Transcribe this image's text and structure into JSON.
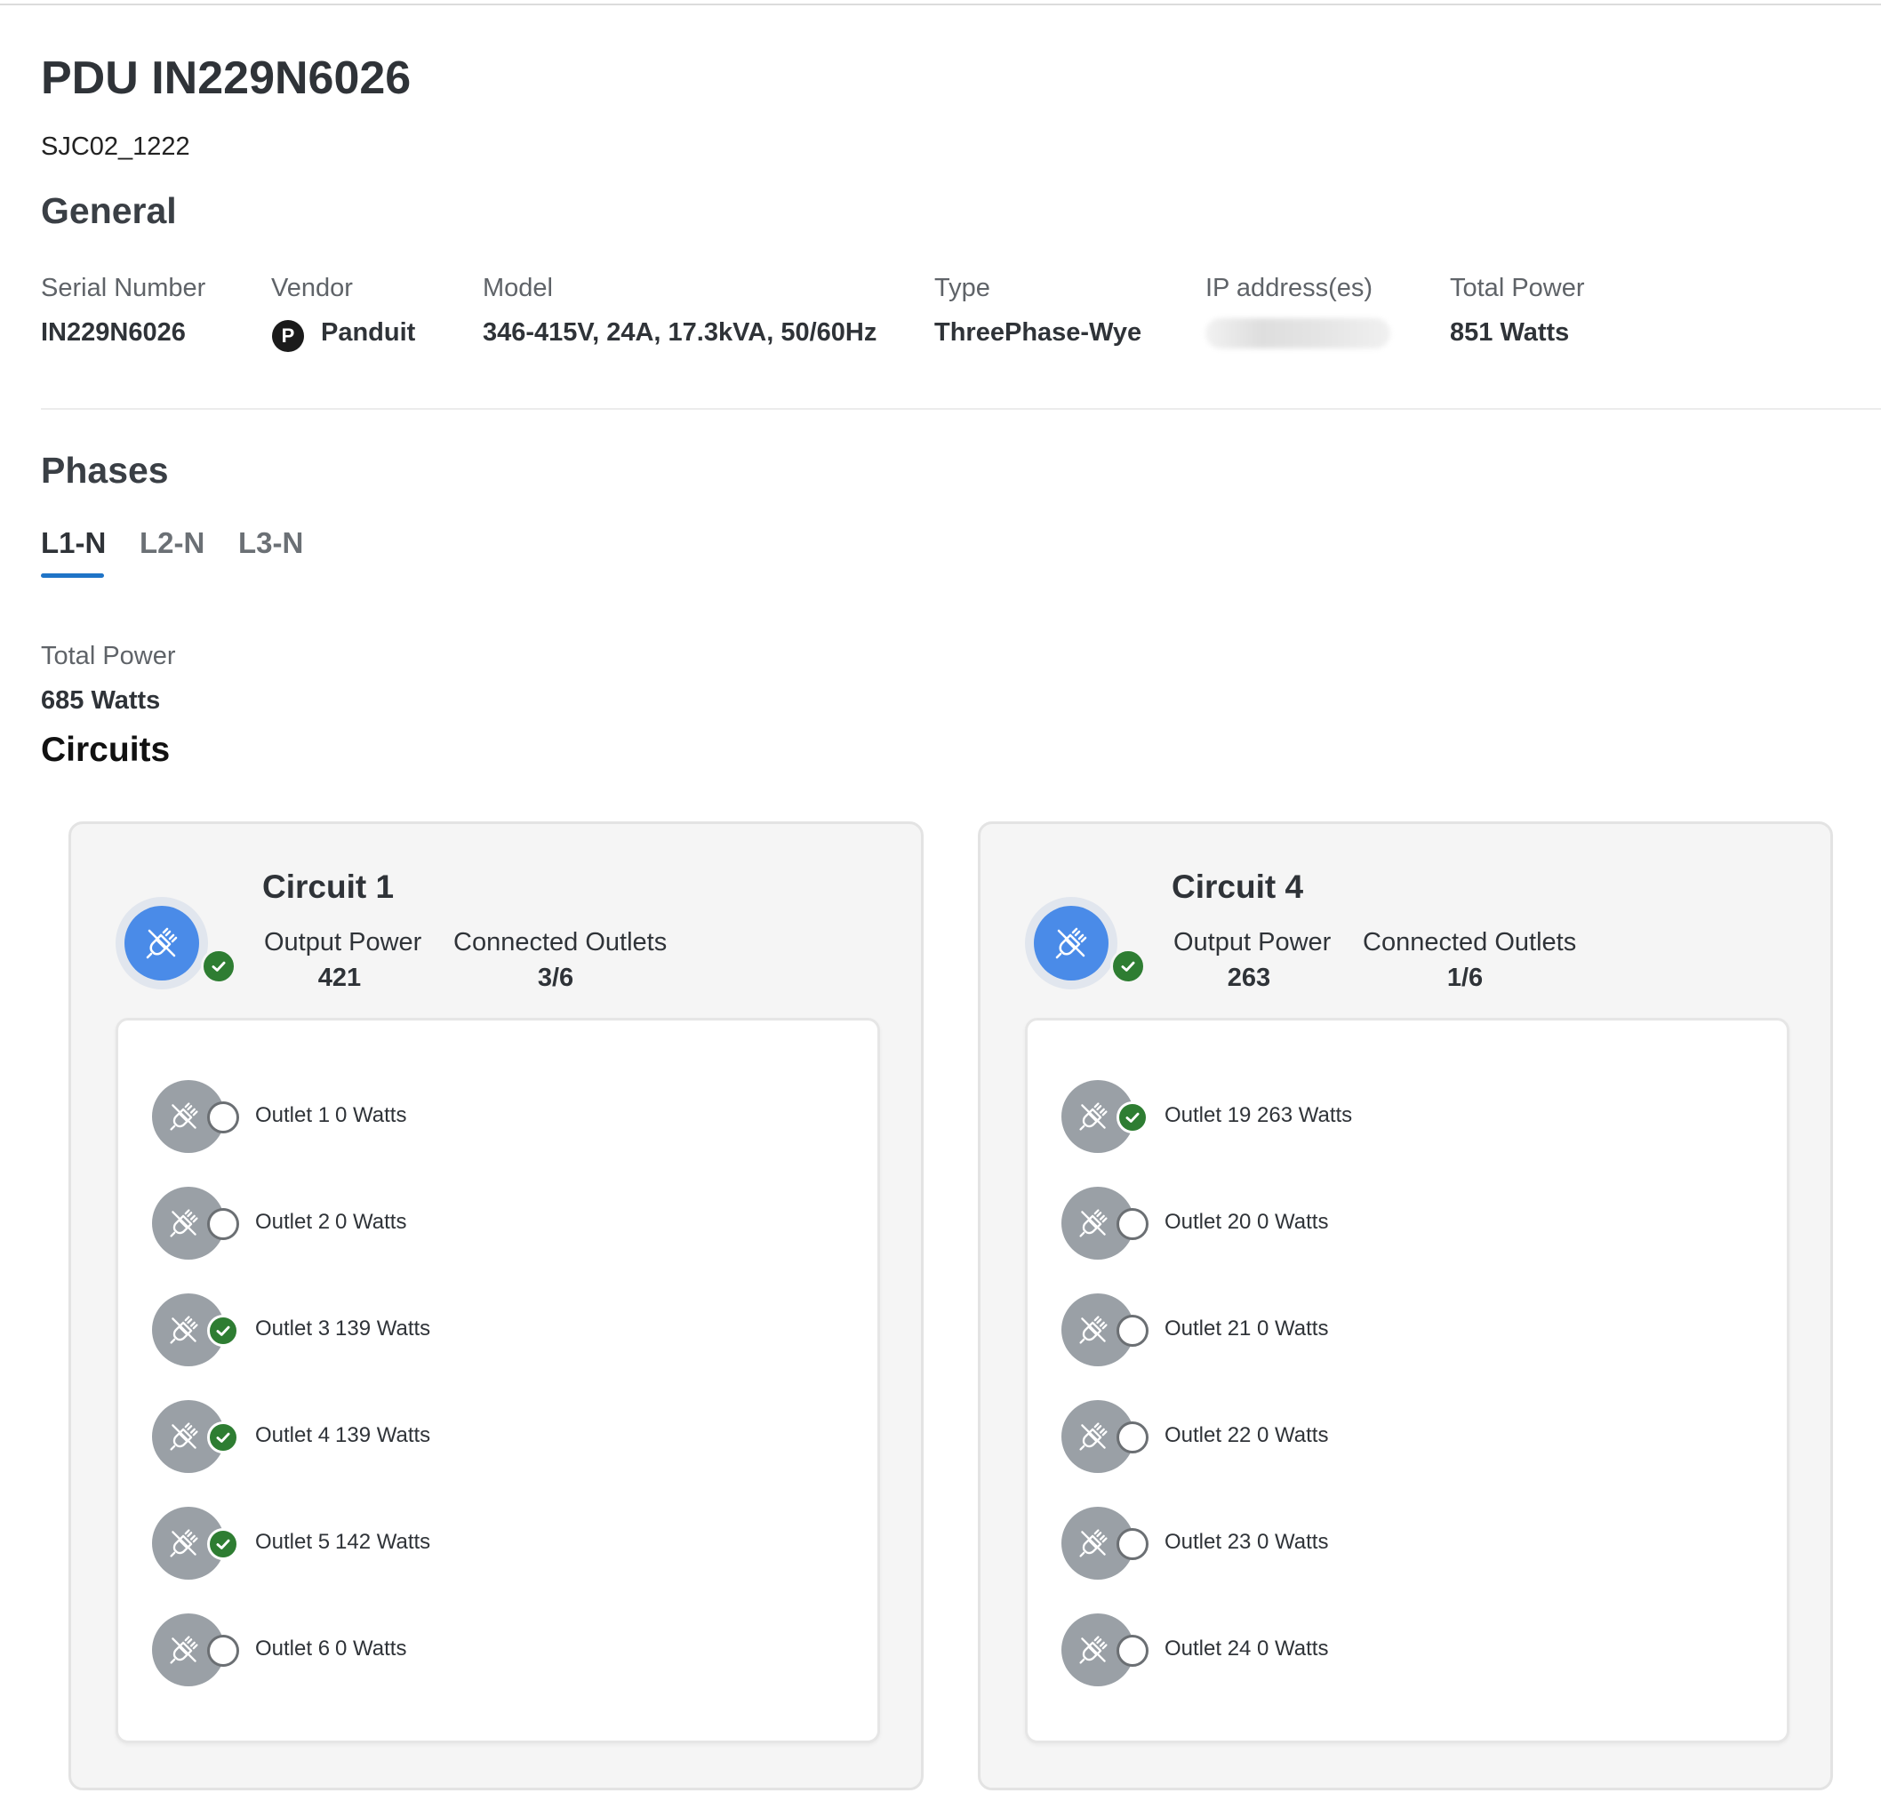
{
  "header": {
    "title": "PDU IN229N6026",
    "subtitle": "SJC02_1222"
  },
  "general": {
    "heading": "General",
    "fields": {
      "serial_label": "Serial Number",
      "serial_value": "IN229N6026",
      "vendor_label": "Vendor",
      "vendor_logo_letter": "P",
      "vendor_value": "Panduit",
      "model_label": "Model",
      "model_value": "346-415V, 24A, 17.3kVA, 50/60Hz",
      "type_label": "Type",
      "type_value": "ThreePhase-Wye",
      "ip_label": "IP address(es)",
      "power_label": "Total Power",
      "power_value": "851 Watts"
    }
  },
  "phases": {
    "heading": "Phases",
    "tabs": [
      {
        "label": "L1-N",
        "active": true
      },
      {
        "label": "L2-N",
        "active": false
      },
      {
        "label": "L3-N",
        "active": false
      }
    ],
    "total_power_label": "Total Power",
    "total_power_value": "685 Watts"
  },
  "circuits": {
    "heading": "Circuits",
    "output_power_label": "Output Power",
    "connected_outlets_label": "Connected Outlets",
    "items": [
      {
        "name": "Circuit 1",
        "status": "ok",
        "output_power": "421",
        "connected_outlets": "3/6",
        "outlets": [
          {
            "name": "Outlet 1",
            "power": "0 Watts",
            "connected": false
          },
          {
            "name": "Outlet 2",
            "power": "0 Watts",
            "connected": false
          },
          {
            "name": "Outlet 3",
            "power": "139 Watts",
            "connected": true
          },
          {
            "name": "Outlet 4",
            "power": "139 Watts",
            "connected": true
          },
          {
            "name": "Outlet 5",
            "power": "142 Watts",
            "connected": true
          },
          {
            "name": "Outlet 6",
            "power": "0 Watts",
            "connected": false
          }
        ]
      },
      {
        "name": "Circuit 4",
        "status": "ok",
        "output_power": "263",
        "connected_outlets": "1/6",
        "outlets": [
          {
            "name": "Outlet 19",
            "power": "263 Watts",
            "connected": true
          },
          {
            "name": "Outlet 20",
            "power": "0 Watts",
            "connected": false
          },
          {
            "name": "Outlet 21",
            "power": "0 Watts",
            "connected": false
          },
          {
            "name": "Outlet 22",
            "power": "0 Watts",
            "connected": false
          },
          {
            "name": "Outlet 23",
            "power": "0 Watts",
            "connected": false
          },
          {
            "name": "Outlet 24",
            "power": "0 Watts",
            "connected": false
          }
        ]
      }
    ]
  },
  "colors": {
    "accent": "#1f74c7",
    "circuit_icon": "#4a8be8",
    "status_ok": "#2e7d32",
    "outlet_icon": "#9aa0a6"
  },
  "icons": {
    "circuit": "power-plug-off-icon",
    "outlet": "power-plug-off-icon",
    "connected": "check-circle-icon",
    "disconnected": "empty-circle-icon"
  }
}
